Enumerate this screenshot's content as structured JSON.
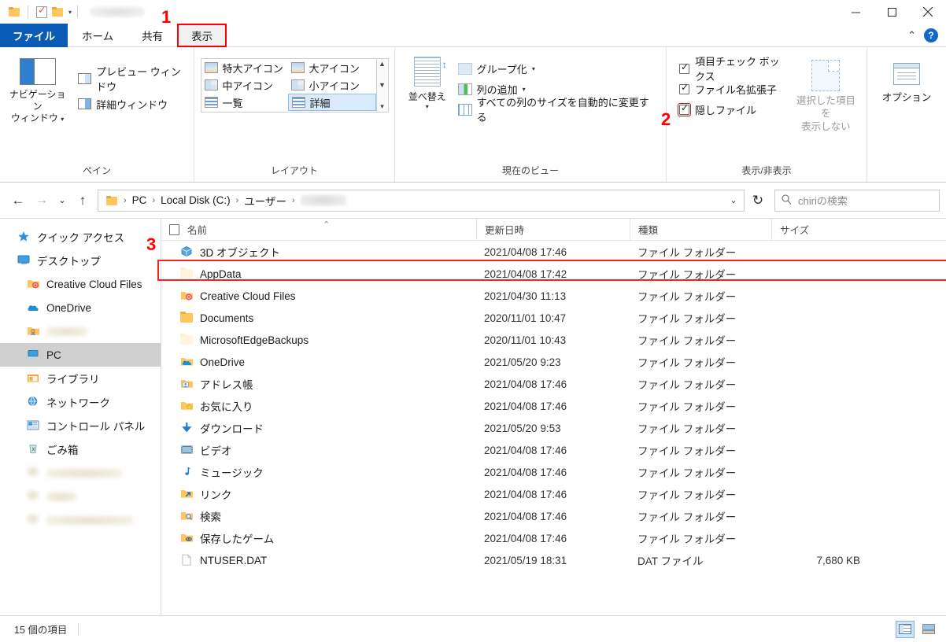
{
  "window": {
    "title_redacted": true,
    "controls": {
      "minimize": "—",
      "maximize": "▢",
      "close": "✕"
    },
    "quick_access": {
      "folder_icon": "folder-icon",
      "properties_icon": "properties-check-icon",
      "newfolder_icon": "new-folder-icon",
      "dropdown": "▾"
    }
  },
  "ribbon": {
    "tabs": [
      {
        "id": "file",
        "label": "ファイル"
      },
      {
        "id": "home",
        "label": "ホーム"
      },
      {
        "id": "share",
        "label": "共有"
      },
      {
        "id": "view",
        "label": "表示"
      }
    ],
    "collapse_caret": "⌃",
    "help_label": "?",
    "groups": [
      {
        "id": "panes",
        "title": "ペイン",
        "big_button": {
          "label_line1": "ナビゲーション",
          "label_line2": "ウィンドウ",
          "caret": "▾"
        },
        "items": [
          {
            "label": "プレビュー ウィンドウ"
          },
          {
            "label": "詳細ウィンドウ"
          }
        ]
      },
      {
        "id": "layout",
        "title": "レイアウト",
        "gallery": [
          {
            "label": "特大アイコン",
            "selected": false
          },
          {
            "label": "大アイコン",
            "selected": false
          },
          {
            "label": "中アイコン",
            "selected": false
          },
          {
            "label": "小アイコン",
            "selected": false
          },
          {
            "label": "一覧",
            "selected": false
          },
          {
            "label": "詳細",
            "selected": true
          }
        ],
        "scroll": {
          "up": "▲",
          "down": "▼",
          "more": "▾"
        }
      },
      {
        "id": "current_view",
        "title": "現在のビュー",
        "sort_button": {
          "label": "並べ替え",
          "caret": "▾"
        },
        "items": [
          {
            "label": "グループ化",
            "caret": "▾"
          },
          {
            "label": "列の追加",
            "caret": "▾"
          },
          {
            "label": "すべての列のサイズを自動的に変更する",
            "caret": ""
          }
        ]
      },
      {
        "id": "show_hide",
        "title": "表示/非表示",
        "checkboxes": [
          {
            "label": "項目チェック ボックス",
            "checked": true,
            "highlight": false
          },
          {
            "label": "ファイル名拡張子",
            "checked": true,
            "highlight": false
          },
          {
            "label": "隠しファイル",
            "checked": true,
            "highlight": true
          }
        ],
        "hide_selected": {
          "line1": "選択した項目を",
          "line2": "表示しない"
        }
      },
      {
        "id": "options",
        "title": "",
        "options_button": {
          "label": "オプション"
        }
      }
    ]
  },
  "addressbar": {
    "back": "←",
    "forward": "→",
    "recent": "⌄",
    "up": "↑",
    "breadcrumbs": [
      {
        "label": "PC",
        "redacted": false
      },
      {
        "label": "Local Disk (C:)",
        "redacted": false
      },
      {
        "label": "ユーザー",
        "redacted": false
      },
      {
        "label": "",
        "redacted": true
      }
    ],
    "separator": "›",
    "dropdown": "⌄",
    "refresh": "↻",
    "search_placeholder": "chiriの検索"
  },
  "sidebar": {
    "items": [
      {
        "label": "クイック アクセス",
        "icon": "star-icon",
        "indent": 0,
        "selected": false,
        "redacted": false
      },
      {
        "label": "デスクトップ",
        "icon": "desktop-icon",
        "indent": 0,
        "selected": false,
        "redacted": false
      },
      {
        "label": "Creative Cloud Files",
        "icon": "creative-cloud-folder-icon",
        "indent": 1,
        "selected": false,
        "redacted": false
      },
      {
        "label": "OneDrive",
        "icon": "onedrive-icon",
        "indent": 1,
        "selected": false,
        "redacted": false
      },
      {
        "label": "",
        "icon": "user-folder-icon",
        "indent": 1,
        "selected": false,
        "redacted": true
      },
      {
        "label": "PC",
        "icon": "pc-icon",
        "indent": 1,
        "selected": true,
        "redacted": false
      },
      {
        "label": "ライブラリ",
        "icon": "library-icon",
        "indent": 1,
        "selected": false,
        "redacted": false
      },
      {
        "label": "ネットワーク",
        "icon": "network-icon",
        "indent": 1,
        "selected": false,
        "redacted": false
      },
      {
        "label": "コントロール パネル",
        "icon": "control-panel-icon",
        "indent": 1,
        "selected": false,
        "redacted": false
      },
      {
        "label": "ごみ箱",
        "icon": "recycle-bin-icon",
        "indent": 1,
        "selected": false,
        "redacted": false
      },
      {
        "label": "",
        "icon": "folder-icon",
        "indent": 1,
        "selected": false,
        "redacted": true
      },
      {
        "label": "",
        "icon": "folder-icon",
        "indent": 1,
        "selected": false,
        "redacted": true
      },
      {
        "label": "",
        "icon": "folder-icon",
        "indent": 1,
        "selected": false,
        "redacted": true
      }
    ]
  },
  "filelist": {
    "columns": [
      {
        "key": "name",
        "label": "名前"
      },
      {
        "key": "date",
        "label": "更新日時"
      },
      {
        "key": "type",
        "label": "種類"
      },
      {
        "key": "size",
        "label": "サイズ"
      }
    ],
    "sort_indicator": "⌃",
    "rows": [
      {
        "name": "3D オブジェクト",
        "date": "2021/04/08 17:46",
        "type": "ファイル フォルダー",
        "size": "",
        "icon": "3d-objects-icon",
        "hidden": false,
        "highlighted": false
      },
      {
        "name": "AppData",
        "date": "2021/04/08 17:42",
        "type": "ファイル フォルダー",
        "size": "",
        "icon": "folder-icon",
        "hidden": true,
        "highlighted": true
      },
      {
        "name": "Creative Cloud Files",
        "date": "2021/04/30 11:13",
        "type": "ファイル フォルダー",
        "size": "",
        "icon": "creative-cloud-folder-icon",
        "hidden": false,
        "highlighted": false
      },
      {
        "name": "Documents",
        "date": "2020/11/01 10:47",
        "type": "ファイル フォルダー",
        "size": "",
        "icon": "folder-icon",
        "hidden": false,
        "highlighted": false
      },
      {
        "name": "MicrosoftEdgeBackups",
        "date": "2020/11/01 10:43",
        "type": "ファイル フォルダー",
        "size": "",
        "icon": "folder-icon",
        "hidden": true,
        "highlighted": false
      },
      {
        "name": "OneDrive",
        "date": "2021/05/20 9:23",
        "type": "ファイル フォルダー",
        "size": "",
        "icon": "onedrive-folder-icon",
        "hidden": false,
        "highlighted": false
      },
      {
        "name": "アドレス帳",
        "date": "2021/04/08 17:46",
        "type": "ファイル フォルダー",
        "size": "",
        "icon": "contacts-folder-icon",
        "hidden": false,
        "highlighted": false
      },
      {
        "name": "お気に入り",
        "date": "2021/04/08 17:46",
        "type": "ファイル フォルダー",
        "size": "",
        "icon": "favorites-folder-icon",
        "hidden": false,
        "highlighted": false
      },
      {
        "name": "ダウンロード",
        "date": "2021/05/20 9:53",
        "type": "ファイル フォルダー",
        "size": "",
        "icon": "downloads-icon",
        "hidden": false,
        "highlighted": false
      },
      {
        "name": "ビデオ",
        "date": "2021/04/08 17:46",
        "type": "ファイル フォルダー",
        "size": "",
        "icon": "videos-icon",
        "hidden": false,
        "highlighted": false
      },
      {
        "name": "ミュージック",
        "date": "2021/04/08 17:46",
        "type": "ファイル フォルダー",
        "size": "",
        "icon": "music-icon",
        "hidden": false,
        "highlighted": false
      },
      {
        "name": "リンク",
        "date": "2021/04/08 17:46",
        "type": "ファイル フォルダー",
        "size": "",
        "icon": "links-folder-icon",
        "hidden": false,
        "highlighted": false
      },
      {
        "name": "検索",
        "date": "2021/04/08 17:46",
        "type": "ファイル フォルダー",
        "size": "",
        "icon": "searches-folder-icon",
        "hidden": false,
        "highlighted": false
      },
      {
        "name": "保存したゲーム",
        "date": "2021/04/08 17:46",
        "type": "ファイル フォルダー",
        "size": "",
        "icon": "saved-games-folder-icon",
        "hidden": false,
        "highlighted": false
      },
      {
        "name": "NTUSER.DAT",
        "date": "2021/05/19 18:31",
        "type": "DAT ファイル",
        "size": "7,680 KB",
        "icon": "dat-file-icon",
        "hidden": false,
        "highlighted": false
      }
    ]
  },
  "statusbar": {
    "item_count": "15 個の項目",
    "views": [
      {
        "name": "details-view",
        "active": true
      },
      {
        "name": "large-thumbnail-view",
        "active": false
      }
    ]
  },
  "annotations": {
    "markers": [
      {
        "number": "1",
        "target": "view-tab"
      },
      {
        "number": "2",
        "target": "hidden-files-checkbox"
      },
      {
        "number": "3",
        "target": "appdata-row"
      }
    ],
    "color": "#ff0000"
  }
}
